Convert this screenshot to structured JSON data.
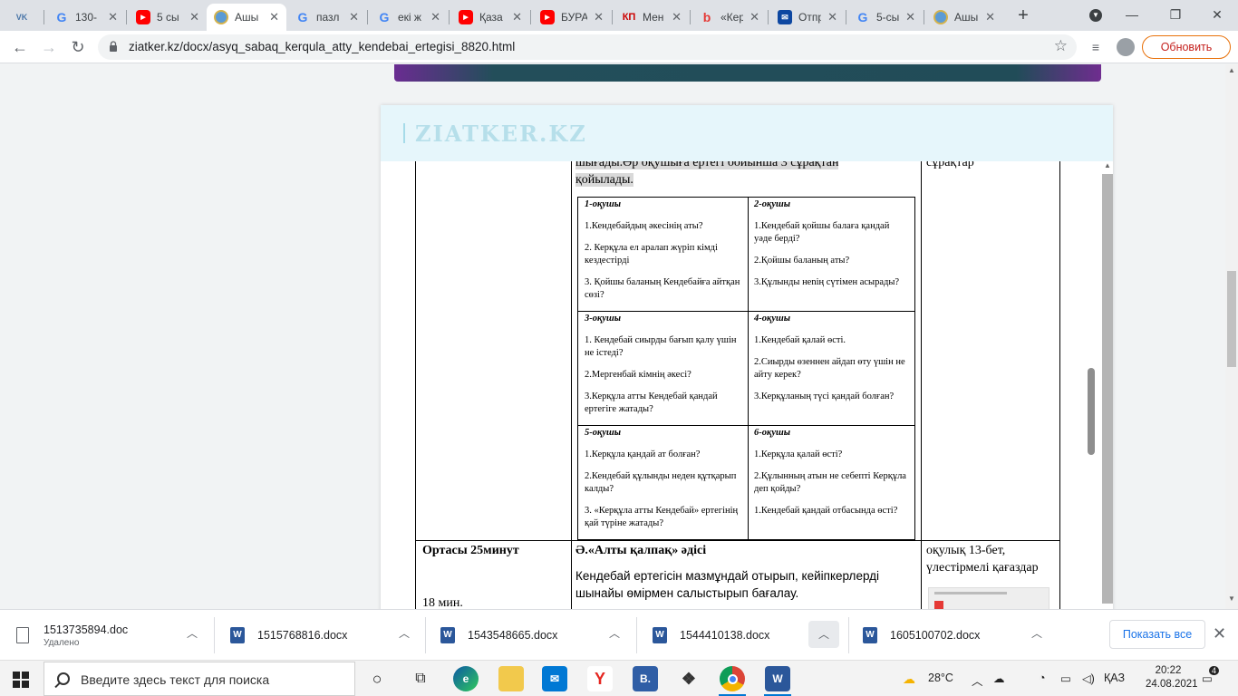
{
  "browser": {
    "tabs": [
      {
        "label": "",
        "icon": "vk-icon",
        "active": false
      },
      {
        "label": "130-",
        "icon": "google-icon",
        "active": false
      },
      {
        "label": "5 сы",
        "icon": "youtube-icon",
        "active": false
      },
      {
        "label": "Ашы",
        "icon": "site-globe-icon",
        "active": true
      },
      {
        "label": "пазл",
        "icon": "google-icon",
        "active": false
      },
      {
        "label": "екі ж",
        "icon": "google-icon",
        "active": false
      },
      {
        "label": "Қаза",
        "icon": "youtube-icon",
        "active": false
      },
      {
        "label": "БУРА",
        "icon": "youtube-icon",
        "active": false
      },
      {
        "label": "Мен",
        "icon": "kp-icon",
        "active": false
      },
      {
        "label": "«Кер",
        "icon": "red-b-icon",
        "active": false
      },
      {
        "label": "Отпр",
        "icon": "mail-icon",
        "active": false
      },
      {
        "label": "5-сы",
        "icon": "google-icon",
        "active": false
      },
      {
        "label": "Ашы",
        "icon": "site-globe-icon",
        "active": false
      }
    ],
    "url": "ziatker.kz/docx/asyq_sabaq_kerqula_atty_kendebai_ertegisi_8820.html",
    "update_label": "Обновить"
  },
  "site": {
    "logo": "ZIATKER.KZ"
  },
  "document": {
    "top_text_line1": "шығады.Әр оқушыға ертегі бойынша 3 сұрақтан",
    "top_text_line2": "қойылады.",
    "right_col_top": "сұрақтар",
    "question_groups": [
      {
        "title": "1-оқушы",
        "questions": [
          "1.Кендебайдың  әкесінің аты?",
          "2. Керқұла ел аралап жүріп кімді кездестірді",
          "3. Қойшы баланың Кендебайға айтқан сөзі?"
        ]
      },
      {
        "title": "2-оқушы",
        "questions": [
          "1.Кендебай қойшы балаға қандай уәде берді?",
          "2.Қойшы баланың аты?",
          "3.Құлынды нenің сүтімен асырады?"
        ]
      },
      {
        "title": "3-оқушы",
        "questions": [
          "1. Кендебай сиырды бағып қалу үшін не істеді?",
          "2.Мергенбай  кімнің әкесі?",
          "3.Керқұла атты Кендебай қандай ертегіге жатады?"
        ]
      },
      {
        "title": "4-оқушы",
        "questions": [
          "1.Кендебай қалай өсті.",
          "2.Сиырды өзеннен айдап өту үшін не айту керек?",
          "3.Керқұланың түсі қандай болған?"
        ]
      },
      {
        "title": "5-оқушы",
        "questions": [
          "1.Керқұла қандай ат болған?",
          "2.Кендебай құлынды неден құтқарып калды?",
          "3. «Керқұла атты Кендебай» ертегінің қай түріне жатады?"
        ]
      },
      {
        "title": "6-оқушы",
        "questions": [
          "1.Керқұла қалай өсті?",
          "2.Құлынның атын не себепті Керқұла деп қойды?",
          "1.Кендебай қандай отбасында өсті?"
        ]
      }
    ],
    "middle_section": {
      "stage_label": "Ортасы 25минут",
      "time_label": "18 мин.",
      "method_title": "Ә.«Алты қалпақ» әдісі",
      "method_desc_line1": "Кендебай ертегісін мазмұндай отырып, кейіпкерлерді",
      "method_desc_line2": "шынайы өмірмен салыстырып бағалау.",
      "resources_line1": "оқулық 13-бет,",
      "resources_line2": "үлестірмелі қағаздар"
    }
  },
  "downloads": {
    "items": [
      {
        "name": "1513735894.doc",
        "status": "Удалено"
      },
      {
        "name": "1515768816.docx",
        "status": ""
      },
      {
        "name": "1543548665.docx",
        "status": ""
      },
      {
        "name": "1544410138.docx",
        "status": ""
      },
      {
        "name": "1605100702.docx",
        "status": ""
      }
    ],
    "show_all_label": "Показать все"
  },
  "taskbar": {
    "search_placeholder": "Введите здесь текст для поиска",
    "weather": "28°C",
    "language": "ҚАЗ",
    "time": "20:22",
    "date": "24.08.2021",
    "notifications_count": "4"
  },
  "colors": {
    "accent_orange": "#e8710a",
    "zbar_bg": "#e6f6fb",
    "logo_color": "#b6dfea",
    "word_blue": "#2b579a"
  }
}
